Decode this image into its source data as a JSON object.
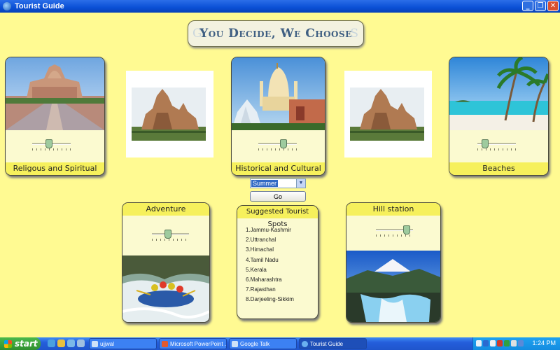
{
  "window": {
    "title": "Tourist Guide",
    "buttons": {
      "minimize": "_",
      "maximize": "❐",
      "close": "✕"
    }
  },
  "banner": {
    "ghost": "G",
    "ghost_right": "S",
    "text": "You Decide, We Choose"
  },
  "cards": {
    "religious": {
      "label": "Religous and Spiritual",
      "slider_value": 0.35
    },
    "heritage": {
      "label": "Historical and Cultural Heritage",
      "slider_value": 0.6
    },
    "beaches": {
      "label": "Beaches",
      "slider_value": 0.2
    },
    "adventure": {
      "label": "Adventure",
      "slider_value": 0.4
    },
    "hill": {
      "label": "Hill station",
      "slider_value": 0.85
    }
  },
  "season_select": {
    "selected": "Summer"
  },
  "go_button": "Go",
  "suggested": {
    "title": "Suggested Tourist Spots",
    "items": [
      "1.Jammu-Kashmir",
      "2.Uttranchal",
      "3.Himachal",
      "4.Tamil Nadu",
      "5.Kerala",
      "6.Maharashtra",
      "7.Rajasthan",
      "8.Darjeeling-Sikkim"
    ]
  },
  "taskbar": {
    "start": "start",
    "tasks": [
      {
        "label": "ujjwal",
        "active": false
      },
      {
        "label": "Microsoft PowerPoint ...",
        "active": false
      },
      {
        "label": "Google Talk",
        "active": false
      },
      {
        "label": "Tourist Guide",
        "active": true
      }
    ],
    "clock": "1:24 PM"
  },
  "colors": {
    "background": "#fffa92",
    "card": "#fbfad0",
    "label_bar": "#f6f05c",
    "banner_text": "#3f5f82"
  }
}
